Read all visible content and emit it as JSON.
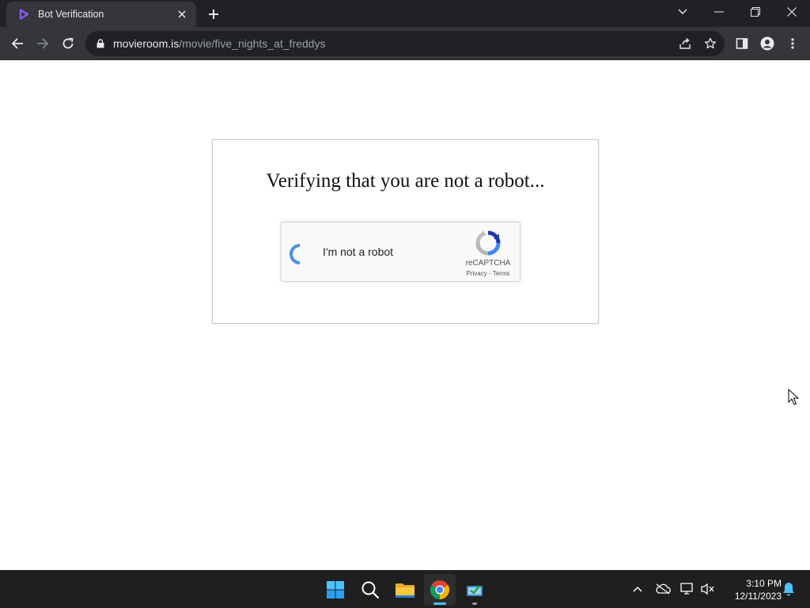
{
  "browser": {
    "tab": {
      "title": "Bot Verification",
      "favicon": "play-logo-icon"
    },
    "address": {
      "host": "movieroom.is",
      "path": "/movie/five_nights_at_freddys"
    }
  },
  "page": {
    "heading": "Verifying that you are not a robot...",
    "captcha": {
      "label": "I'm not a robot",
      "brand": "reCAPTCHA",
      "privacy": "Privacy",
      "separator": " - ",
      "terms": "Terms"
    }
  },
  "taskbar": {
    "apps": [
      "start-icon",
      "search-icon",
      "file-explorer-icon",
      "chrome-icon",
      "app-icon"
    ],
    "clock": {
      "time": "3:10 PM",
      "date": "12/11/2023"
    }
  },
  "colors": {
    "accent": "#8ab4f8",
    "favicon": "#7c4dff",
    "spinner": "#4a90e2"
  }
}
